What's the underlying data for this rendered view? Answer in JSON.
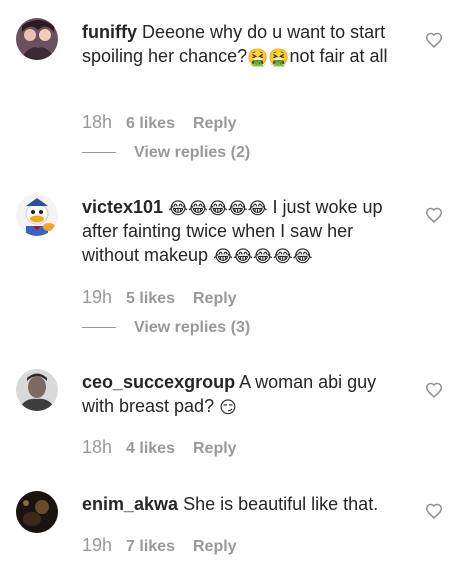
{
  "comments": [
    {
      "username": "funiffy",
      "text_before": "Deeone why do u want to start spoiling her chance?",
      "emojis_inline": [
        "🤮",
        "🤮"
      ],
      "text_after": "not fair at all",
      "time": "18h",
      "likes": "6 likes",
      "reply": "Reply",
      "view_replies": "View replies (2)",
      "avatar": "avatar-photo"
    },
    {
      "username": "victex101",
      "emojis_lead": [
        "😂",
        "😂",
        "😂",
        "😂",
        "😂"
      ],
      "text_before": "I just woke up after fainting twice when I saw her without makeup",
      "emojis_trail": [
        "😂",
        "😂",
        "😂",
        "😂",
        "😂"
      ],
      "time": "19h",
      "likes": "5 likes",
      "reply": "Reply",
      "view_replies": "View replies (3)",
      "avatar": "donald-duck-avatar"
    },
    {
      "username": "ceo_succexgroup",
      "text_before": "A woman abi guy with breast pad?",
      "emojis_trail": [
        "😏"
      ],
      "time": "18h",
      "likes": "4 likes",
      "reply": "Reply",
      "avatar": "avatar-photo"
    },
    {
      "username": "enim_akwa",
      "text_before": "She is beautiful like that.",
      "time": "19h",
      "likes": "7 likes",
      "reply": "Reply",
      "avatar": "avatar-photo"
    }
  ],
  "icons": {
    "like": "heart-outline-icon"
  },
  "colors": {
    "text": "#262626",
    "muted": "#999999",
    "background": "#ffffff"
  }
}
